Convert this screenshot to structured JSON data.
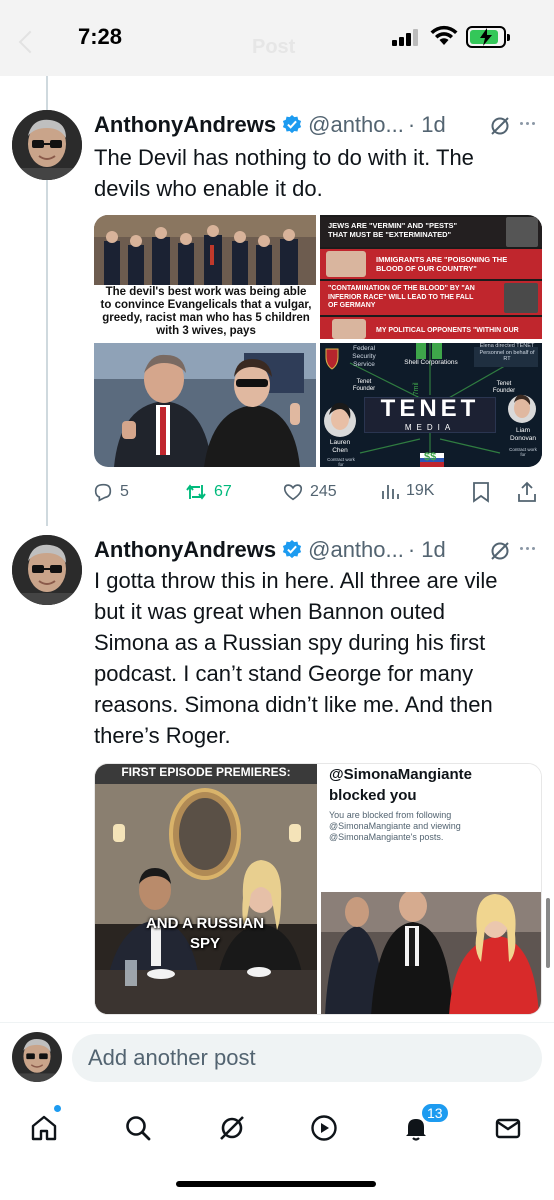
{
  "status_bar": {
    "time": "7:28",
    "ghost_title": "Post"
  },
  "posts": [
    {
      "name": "AnthonyAndrews",
      "handle": "@antho...",
      "age": "· 1d",
      "text": "The Devil has nothing to do with it. The devils who enable it do.",
      "media": {
        "caption_1": "The devil's best work was being able to convince Evangelicals that a vulgar, greedy, racist man who has 5 children with 3 wives, pays",
        "quote_1": "JEWS ARE \"VERMIN\" AND \"PESTS\" THAT MUST BE \"EXTERMINATED\"",
        "quote_2": "IMMIGRANTS ARE \"POISONING THE BLOOD OF OUR COUNTRY\"",
        "quote_3": "\"CONTAMINATION OF THE BLOOD\" BY \"AN INFERIOR RACE\" WILL LEAD TO THE FALL OF GERMANY",
        "quote_4": "MY POLITICAL OPPONENTS \"WITHIN OUR",
        "tenet": {
          "logo": "TENET",
          "sub": "MEDIA",
          "fsb": "Federal Security Service",
          "shell": "Shell Corporations",
          "elena": "Elena directed TENET Personnel on behalf of RT",
          "founder_left": "Tenet Founder",
          "founder_right": "Tenet Founder",
          "lauren": "Lauren Chen",
          "liam": "Liam Donovan",
          "contract_left": "Contract work for",
          "contract_right": "Contract work for",
          "money": "$9.7mil",
          "dollar": "$$"
        }
      },
      "stats": {
        "replies": "5",
        "reposts": "67",
        "likes": "245",
        "views": "19K"
      }
    },
    {
      "name": "AnthonyAndrews",
      "handle": "@antho...",
      "age": "· 1d",
      "text": "I gotta throw this in here. All three are vile but it was great when Bannon outed Simona as a Russian spy during his first podcast. I can’t stand George for many reasons. Simona didn’t like me. And then there’s Roger.",
      "media": {
        "banner": "FIRST EPISODE PREMIERES:",
        "overlay": "AND A RUSSIAN SPY",
        "blocked_handle": "@SimonaMangiante",
        "blocked_title": "blocked you",
        "blocked_desc": "You are blocked from following @SimonaMangiante and viewing @SimonaMangiante's posts."
      }
    }
  ],
  "reply": {
    "placeholder": "Add another post"
  },
  "tabbar": {
    "notifications_badge": "13"
  },
  "colors": {
    "accent": "#1d9bf0",
    "repost": "#00ba7c",
    "muted": "#536471"
  }
}
